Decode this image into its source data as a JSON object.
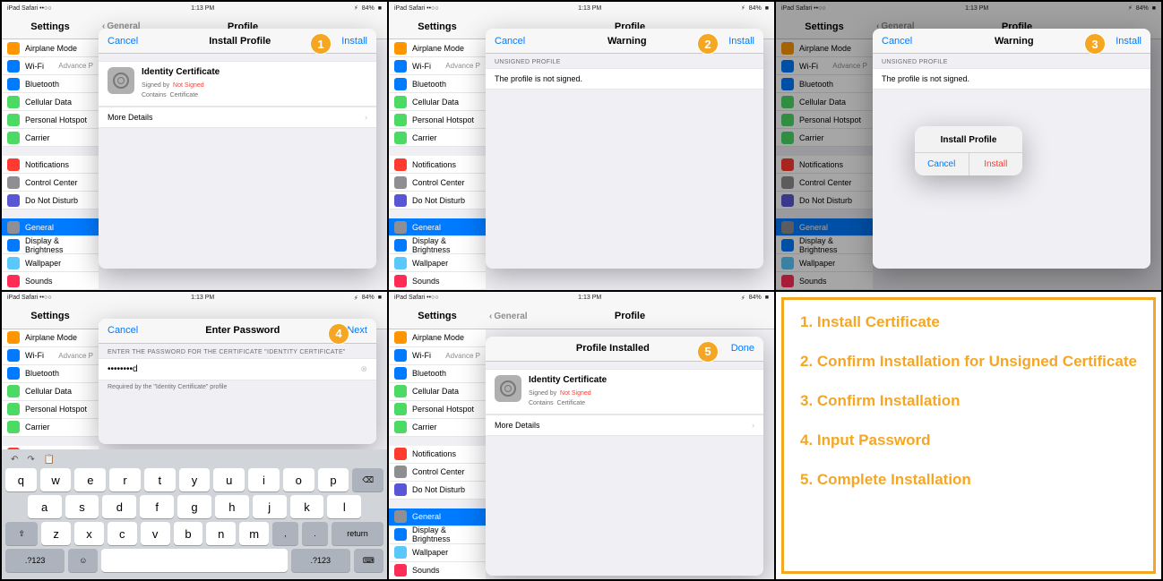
{
  "status": {
    "left": "iPad Safari ••○○",
    "time": "1:13 PM",
    "batt": "84%"
  },
  "nav": {
    "settings": "Settings",
    "profile": "Profile",
    "back": "General"
  },
  "sidebar": {
    "g1": [
      {
        "label": "Airplane Mode",
        "color": "#ff9500"
      },
      {
        "label": "Wi-Fi",
        "color": "#007aff",
        "detail": "Advance P"
      },
      {
        "label": "Bluetooth",
        "color": "#007aff"
      },
      {
        "label": "Cellular Data",
        "color": "#4cd964"
      },
      {
        "label": "Personal Hotspot",
        "color": "#4cd964"
      },
      {
        "label": "Carrier",
        "color": "#4cd964"
      }
    ],
    "g2": [
      {
        "label": "Notifications",
        "color": "#ff3b30"
      },
      {
        "label": "Control Center",
        "color": "#8e8e93"
      },
      {
        "label": "Do Not Disturb",
        "color": "#5856d6"
      }
    ],
    "g3": [
      {
        "label": "General",
        "color": "#8e8e93",
        "sel": true
      },
      {
        "label": "Display & Brightness",
        "color": "#007aff"
      },
      {
        "label": "Wallpaper",
        "color": "#5ac8fa"
      },
      {
        "label": "Sounds",
        "color": "#ff2d55"
      }
    ]
  },
  "sheet1": {
    "cancel": "Cancel",
    "title": "Install Profile",
    "action": "Install",
    "cert_name": "Identity Certificate",
    "signed_lbl": "Signed by",
    "signed_val": "Not Signed",
    "contains_lbl": "Contains",
    "contains_val": "Certificate",
    "more": "More Details"
  },
  "sheet2": {
    "cancel": "Cancel",
    "title": "Warning",
    "action": "Install",
    "section": "UNSIGNED PROFILE",
    "msg": "The profile is not signed."
  },
  "alert3": {
    "title": "Install Profile",
    "cancel": "Cancel",
    "install": "Install"
  },
  "sheet4": {
    "cancel": "Cancel",
    "title": "Enter Password",
    "action": "Next",
    "prompt": "ENTER THE PASSWORD FOR THE CERTIFICATE \"IDENTITY CERTIFICATE\"",
    "value": "••••••••d",
    "note": "Required by the \"Identity Certificate\" profile"
  },
  "sheet5": {
    "title": "Profile Installed",
    "action": "Done",
    "cert_name": "Identity Certificate",
    "signed_lbl": "Signed by",
    "signed_val": "Not Signed",
    "contains_lbl": "Contains",
    "contains_val": "Certificate",
    "more": "More Details"
  },
  "keyboard": {
    "r1": [
      "q",
      "w",
      "e",
      "r",
      "t",
      "y",
      "u",
      "i",
      "o",
      "p"
    ],
    "r2": [
      "a",
      "s",
      "d",
      "f",
      "g",
      "h",
      "j",
      "k",
      "l"
    ],
    "r3": [
      "z",
      "x",
      "c",
      "v",
      "b",
      "n",
      "m"
    ],
    "shift": "⇧",
    "bksp": "⌫",
    "return": "return",
    "num": ".?123",
    "space": "",
    "kb": "⌨"
  },
  "legend": {
    "i1": "1. Install Certificate",
    "i2": "2. Confirm Installation for Unsigned Certificate",
    "i3": "3. Confirm Installation",
    "i4": "4. Input Password",
    "i5": "5. Complete Installation"
  },
  "badges": {
    "b1": "1",
    "b2": "2",
    "b3": "3",
    "b4": "4",
    "b5": "5"
  }
}
